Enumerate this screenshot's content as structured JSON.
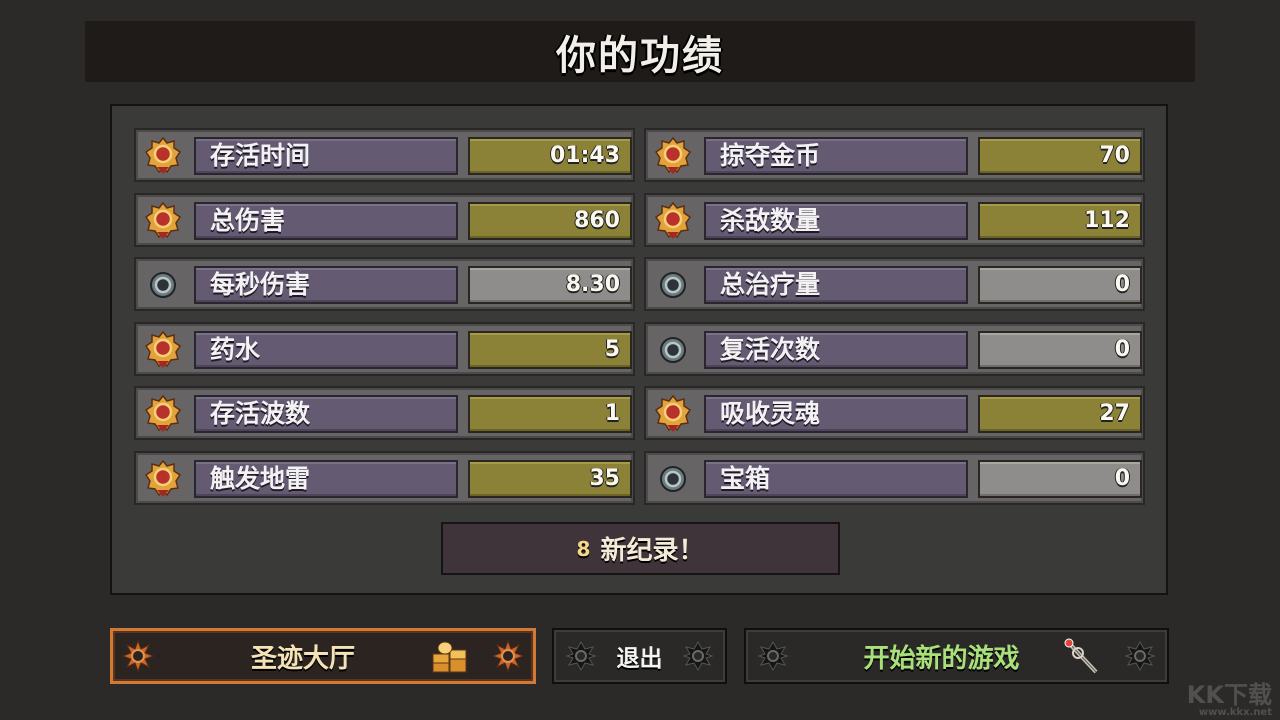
{
  "title": "你的功绩",
  "stats": [
    {
      "label": "存活时间",
      "value": "01:43",
      "style": "gold",
      "icon": "gold-medal-icon"
    },
    {
      "label": "掠夺金币",
      "value": "70",
      "style": "gold",
      "icon": "gold-medal-icon"
    },
    {
      "label": "总伤害",
      "value": "860",
      "style": "gold",
      "icon": "gold-medal-icon"
    },
    {
      "label": "杀敌数量",
      "value": "112",
      "style": "gold",
      "icon": "gold-medal-icon"
    },
    {
      "label": "每秒伤害",
      "value": "8.30",
      "style": "grey",
      "icon": "silver-medal-icon"
    },
    {
      "label": "总治疗量",
      "value": "0",
      "style": "grey",
      "icon": "silver-medal-icon"
    },
    {
      "label": "药水",
      "value": "5",
      "style": "gold",
      "icon": "gold-medal-icon"
    },
    {
      "label": "复活次数",
      "value": "0",
      "style": "grey",
      "icon": "silver-medal-icon"
    },
    {
      "label": "存活波数",
      "value": "1",
      "style": "gold",
      "icon": "gold-medal-icon"
    },
    {
      "label": "吸收灵魂",
      "value": "27",
      "style": "gold",
      "icon": "gold-medal-icon"
    },
    {
      "label": "触发地雷",
      "value": "35",
      "style": "gold",
      "icon": "gold-medal-icon"
    },
    {
      "label": "宝箱",
      "value": "0",
      "style": "grey",
      "icon": "silver-medal-icon"
    }
  ],
  "records": {
    "count": "8",
    "text": "新纪录！"
  },
  "buttons": {
    "hall": {
      "label": "圣迹大厅",
      "icon": "coin-stack-icon"
    },
    "exit": {
      "label": "退出"
    },
    "new_game": {
      "label": "开始新的游戏",
      "icon": "staff-icon"
    }
  },
  "watermark": {
    "main": "KK下载",
    "url": "www.kkx.net"
  },
  "colors": {
    "gold_value": "#8b8238",
    "grey_value": "#8e8d8b",
    "label_bg": "#645b73",
    "hall_border": "#d07a33",
    "new_game_text": "#a9e07a"
  }
}
